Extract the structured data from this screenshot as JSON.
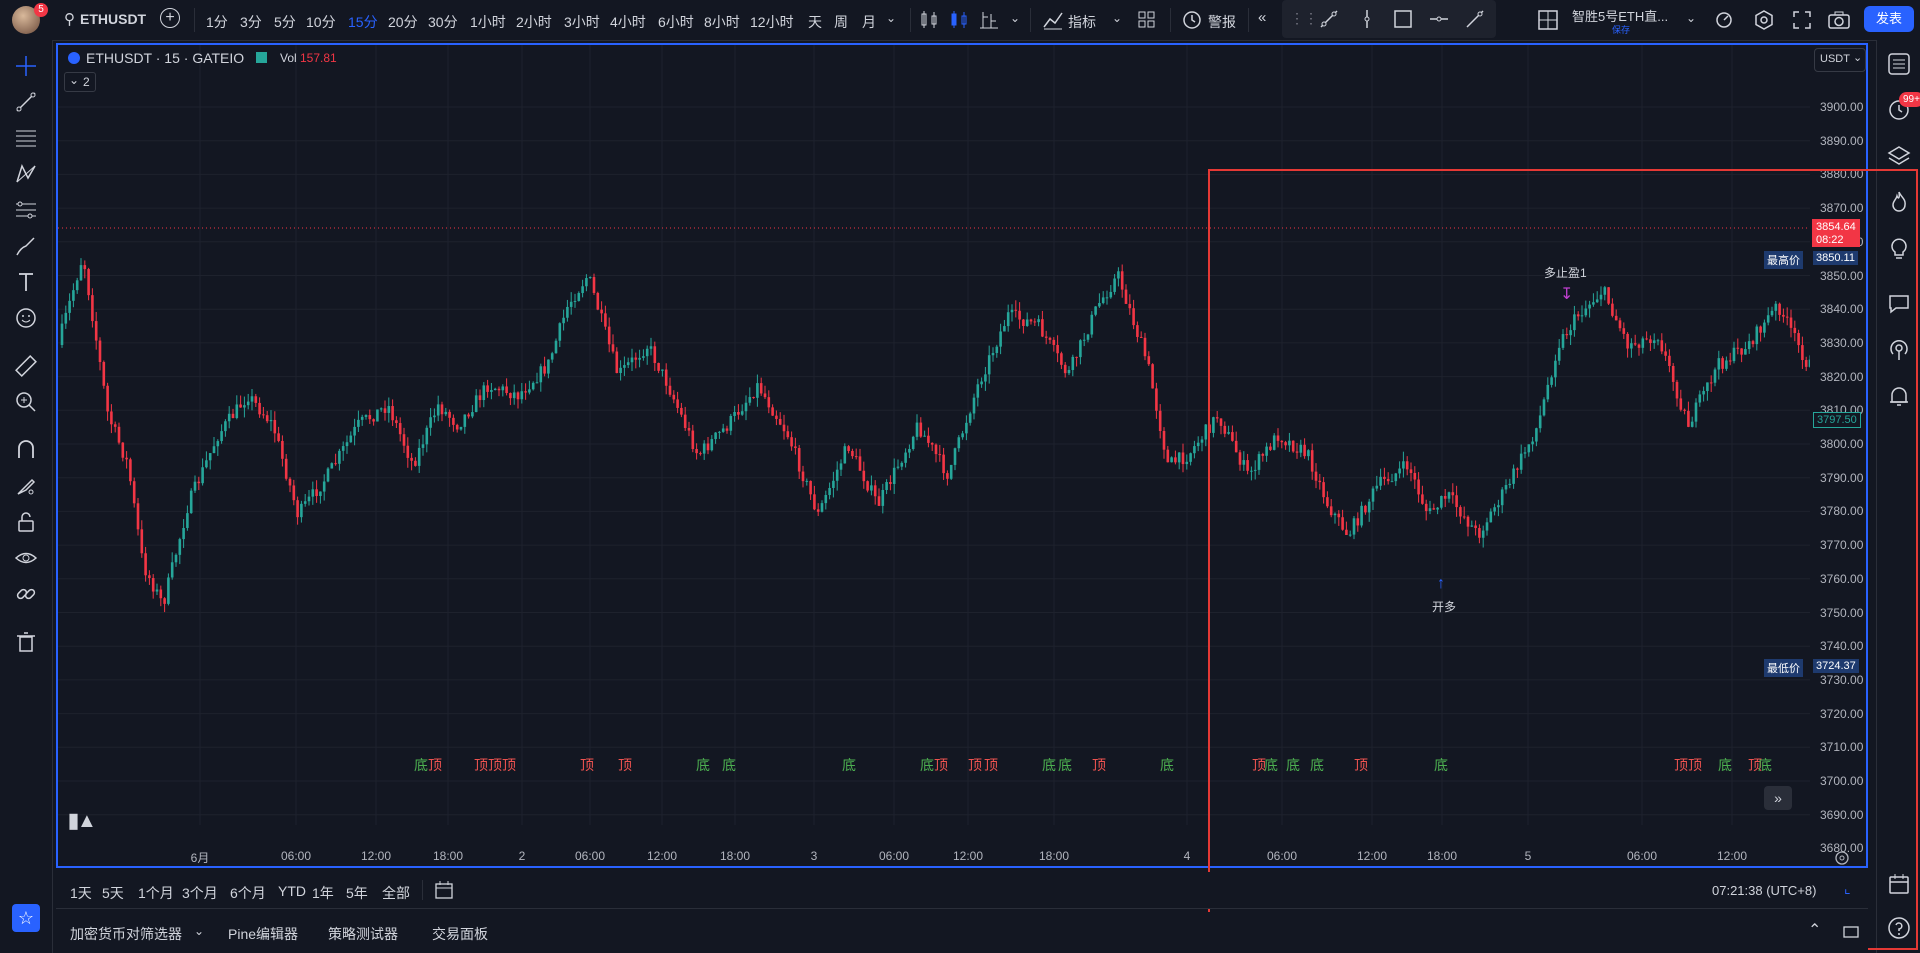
{
  "colors": {
    "accent": "#2962ff",
    "up": "#26a69a",
    "down": "#f23645",
    "bg": "#131722",
    "highlight_box": "#e53935"
  },
  "header": {
    "avatar_badge": "5",
    "symbol": "ETHUSDT",
    "timeframes": [
      "1分",
      "3分",
      "5分",
      "10分",
      "15分",
      "20分",
      "30分",
      "1小时",
      "2小时",
      "3小时",
      "4小时",
      "6小时",
      "8小时",
      "12小时",
      "天",
      "周",
      "月"
    ],
    "active_timeframe": "15分",
    "indicators_label": "指标",
    "alert_label": "警报",
    "layout_name": "智胜5号ETH直...",
    "layout_sub": "保存",
    "publish_label": "发表"
  },
  "legend": {
    "title": "ETHUSDT · 15 · GATEIO",
    "vol_label": "Vol",
    "vol_value": "157.81",
    "collapse_count": "2"
  },
  "currency": "USDT",
  "price_axis": {
    "ticks": [
      "3900.00",
      "3890.00",
      "3880.00",
      "3870.00",
      "3860.00",
      "3850.00",
      "3840.00",
      "3830.00",
      "3820.00",
      "3810.00",
      "3800.00",
      "3790.00",
      "3780.00",
      "3770.00",
      "3760.00",
      "3750.00",
      "3740.00",
      "3730.00",
      "3720.00",
      "3710.00",
      "3700.00",
      "3690.00",
      "3680.00"
    ],
    "last_price": "3854.64",
    "countdown": "08:22",
    "high_label": "最高价",
    "high_value": "3850.11",
    "low_label": "最低价",
    "low_value": "3724.37",
    "cursor_price": "3797.50"
  },
  "time_axis": [
    "6月",
    "06:00",
    "12:00",
    "18:00",
    "2",
    "06:00",
    "12:00",
    "18:00",
    "3",
    "06:00",
    "12:00",
    "18:00",
    "4",
    "06:00",
    "12:00",
    "18:00",
    "5",
    "06:00",
    "12:00"
  ],
  "signals": [
    {
      "t": "底",
      "k": "bot"
    },
    {
      "t": "顶",
      "k": "top"
    },
    {
      "t": "顶",
      "k": "top"
    },
    {
      "t": "顶",
      "k": "top"
    },
    {
      "t": "顶",
      "k": "top"
    },
    {
      "t": "顶",
      "k": "top"
    },
    {
      "t": "顶",
      "k": "top"
    },
    {
      "t": "底",
      "k": "bot"
    },
    {
      "t": "底",
      "k": "bot"
    },
    {
      "t": "底",
      "k": "bot"
    },
    {
      "t": "底",
      "k": "bot"
    },
    {
      "t": "顶",
      "k": "top"
    },
    {
      "t": "顶",
      "k": "top"
    },
    {
      "t": "顶",
      "k": "top"
    },
    {
      "t": "底",
      "k": "bot"
    },
    {
      "t": "底",
      "k": "bot"
    },
    {
      "t": "顶",
      "k": "top"
    },
    {
      "t": "底",
      "k": "bot"
    },
    {
      "t": "顶",
      "k": "top"
    },
    {
      "t": "底",
      "k": "bot"
    },
    {
      "t": "底",
      "k": "bot"
    },
    {
      "t": "底",
      "k": "bot"
    },
    {
      "t": "顶",
      "k": "top"
    },
    {
      "t": "底",
      "k": "bot"
    },
    {
      "t": "顶",
      "k": "top"
    },
    {
      "t": "顶",
      "k": "top"
    },
    {
      "t": "底",
      "k": "bot"
    },
    {
      "t": "顶",
      "k": "top"
    },
    {
      "t": "底",
      "k": "bot"
    }
  ],
  "annotations": {
    "long_open": "开多",
    "take_profit": "多止盈1"
  },
  "ranges": [
    "1天",
    "5天",
    "1个月",
    "3个月",
    "6个月",
    "YTD",
    "1年",
    "5年",
    "全部"
  ],
  "clock": "07:21:38 (UTC+8)",
  "panels": [
    "加密货币对筛选器",
    "Pine编辑器",
    "策略测试器",
    "交易面板"
  ],
  "notif_badge": "99+"
}
